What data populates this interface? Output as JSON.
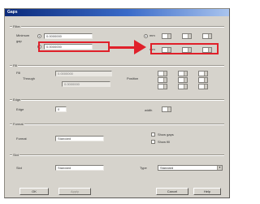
{
  "window": {
    "title": "Gaps"
  },
  "groups": {
    "filter": "Filter",
    "fill": "Fill",
    "edge": "Edge",
    "format": "Format",
    "slot": "Slot"
  },
  "filter": {
    "row1_label": "Minimum",
    "row1_value": "0.0000000",
    "row1_unit": "mm",
    "row2_label": "Maximum",
    "row2_value": "0.0000000",
    "row2_unit": "mm",
    "side_label": "gap"
  },
  "fill": {
    "label1": "Fill",
    "label2": "Through",
    "value1": "0.0000000",
    "value2": "0.0000000",
    "mid_label": "Position"
  },
  "edge": {
    "label": "Edge",
    "value": "0",
    "right_label": "width"
  },
  "format": {
    "label": "Format",
    "value": "Standard",
    "opt1": "Show gaps",
    "opt2": "Show fill"
  },
  "slot": {
    "label": "Slot",
    "value": "Standard",
    "right_label": "Type",
    "combo_value": "Standard"
  },
  "buttons": {
    "ok": "OK",
    "apply": "Apply",
    "cancel": "Cancel",
    "help": "Help"
  }
}
